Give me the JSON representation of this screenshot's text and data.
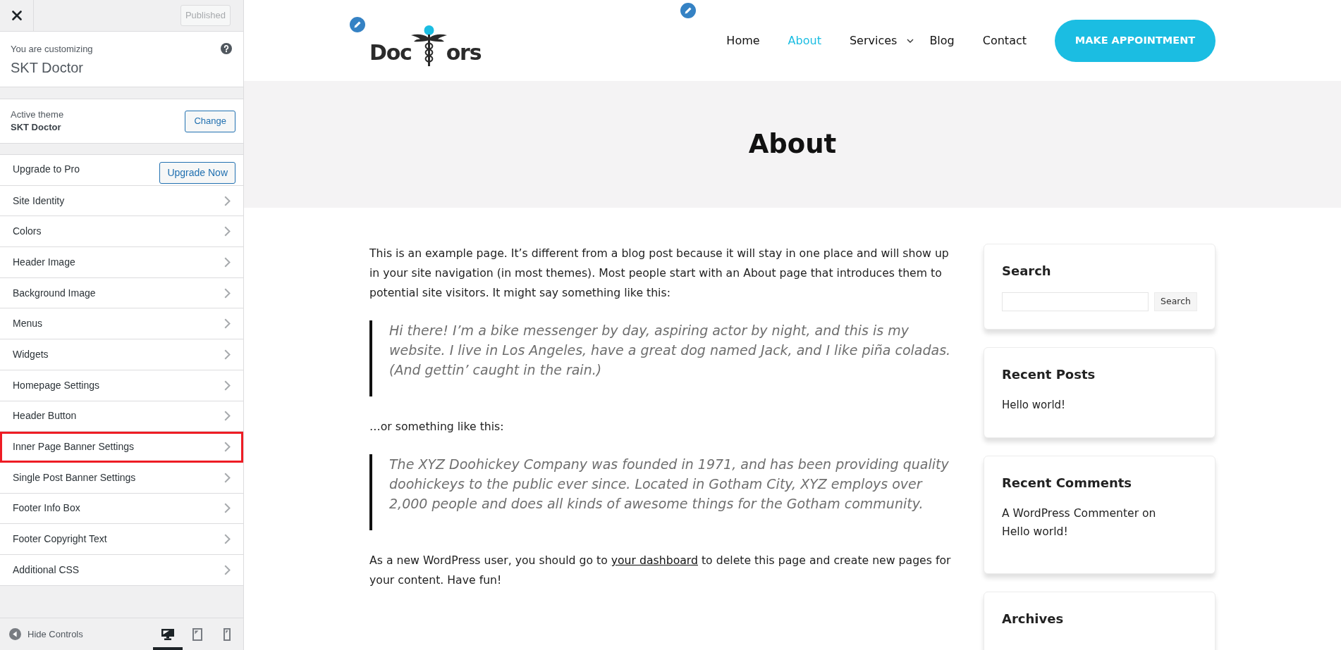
{
  "customizer": {
    "publish_button": {
      "label": "Published",
      "disabled": true
    },
    "info": {
      "label": "You are customizing",
      "title": "SKT Doctor"
    },
    "theme": {
      "label": "Active theme",
      "name": "SKT Doctor",
      "button": "Change"
    },
    "sections": [
      {
        "kind": "upgrade",
        "label": "Upgrade to Pro",
        "button": "Upgrade Now",
        "highlighted": false
      },
      {
        "kind": "section",
        "label": "Site Identity",
        "highlighted": false
      },
      {
        "kind": "section",
        "label": "Colors",
        "highlighted": false
      },
      {
        "kind": "section",
        "label": "Header Image",
        "highlighted": false
      },
      {
        "kind": "section",
        "label": "Background Image",
        "highlighted": false
      },
      {
        "kind": "section",
        "label": "Menus",
        "highlighted": false
      },
      {
        "kind": "section",
        "label": "Widgets",
        "highlighted": false
      },
      {
        "kind": "section",
        "label": "Homepage Settings",
        "highlighted": false
      },
      {
        "kind": "section",
        "label": "Header Button",
        "highlighted": false
      },
      {
        "kind": "section",
        "label": "Inner Page Banner Settings",
        "highlighted": true
      },
      {
        "kind": "section",
        "label": "Single Post Banner Settings",
        "highlighted": false
      },
      {
        "kind": "section",
        "label": "Footer Info Box",
        "highlighted": false
      },
      {
        "kind": "section",
        "label": "Footer Copyright Text",
        "highlighted": false
      },
      {
        "kind": "section",
        "label": "Additional CSS",
        "highlighted": false
      }
    ],
    "footer": {
      "toggle": "Hide Controls",
      "devices": [
        {
          "kind": "desktop",
          "selected": true
        },
        {
          "kind": "tablet",
          "selected": false
        },
        {
          "kind": "mobile",
          "selected": false
        }
      ]
    }
  },
  "preview": {
    "logo": {
      "before": "Doc",
      "after": "ors"
    },
    "nav": [
      {
        "label": "Home",
        "selected": false,
        "has_submenu": false
      },
      {
        "label": "About",
        "selected": true,
        "has_submenu": false
      },
      {
        "label": "Services",
        "selected": false,
        "has_submenu": true
      },
      {
        "label": "Blog",
        "selected": false,
        "has_submenu": false
      },
      {
        "label": "Contact",
        "selected": false,
        "has_submenu": false
      }
    ],
    "cta_button": "MAKE APPOINTMENT",
    "page_title": "About",
    "content": [
      {
        "kind": "paragraph",
        "parts": [
          {
            "kind": "text",
            "text": "This is an example page. It’s different from a blog post because it will stay in one place and will show up in your site navigation (in most themes). Most people start with an About page that introduces them to potential site visitors. It might say something like this:"
          }
        ]
      },
      {
        "kind": "quote",
        "text": "Hi there! I’m a bike messenger by day, aspiring actor by night, and this is my website. I live in Los Angeles, have a great dog named Jack, and I like piña coladas. (And gettin’ caught in the rain.)"
      },
      {
        "kind": "paragraph",
        "parts": [
          {
            "kind": "text",
            "text": "…or something like this:"
          }
        ]
      },
      {
        "kind": "quote",
        "text": "The XYZ Doohickey Company was founded in 1971, and has been providing quality doohickeys to the public ever since. Located in Gotham City, XYZ employs over 2,000 people and does all kinds of awesome things for the Gotham community."
      },
      {
        "kind": "paragraph",
        "parts": [
          {
            "kind": "text",
            "text": "As a new WordPress user, you should go to "
          },
          {
            "kind": "link",
            "text": "your dashboard"
          },
          {
            "kind": "text",
            "text": " to delete this page and create new pages for your content. Have fun!"
          }
        ]
      }
    ],
    "widgets": [
      {
        "kind": "search",
        "title": "Search",
        "button": "Search"
      },
      {
        "kind": "posts",
        "title": "Recent Posts",
        "items": [
          "Hello world!"
        ]
      },
      {
        "kind": "comments",
        "title": "Recent Comments",
        "items": [
          {
            "parts": [
              {
                "kind": "link",
                "text": "A WordPress Commenter"
              },
              {
                "kind": "text",
                "text": " on "
              },
              {
                "kind": "link",
                "text": "Hello world!"
              }
            ]
          }
        ]
      },
      {
        "kind": "posts",
        "title": "Archives"
      }
    ]
  }
}
